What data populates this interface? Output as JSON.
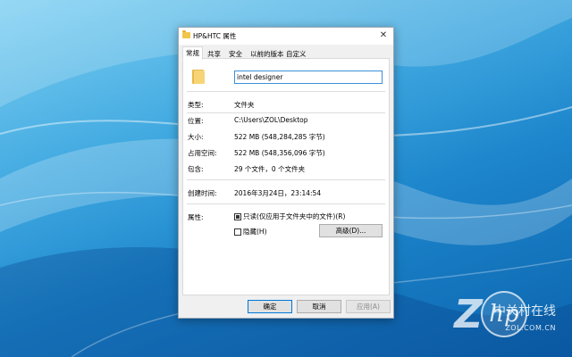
{
  "window": {
    "title": "HP&HTC 属性",
    "close_glyph": "✕"
  },
  "tabs": [
    {
      "label": "常规",
      "active": true
    },
    {
      "label": "共享"
    },
    {
      "label": "安全"
    },
    {
      "label": "以前的版本"
    },
    {
      "label": "自定义"
    }
  ],
  "general": {
    "name_value": "intel designer",
    "type_label": "类型:",
    "type_value": "文件夹",
    "location_label": "位置:",
    "location_value": "C:\\Users\\ZOL\\Desktop",
    "size_label": "大小:",
    "size_value": "522 MB (548,284,285 字节)",
    "size_on_disk_label": "占用空间:",
    "size_on_disk_value": "522 MB (548,356,096 字节)",
    "contains_label": "包含:",
    "contains_value": "29 个文件，0 个文件夹",
    "created_label": "创建时间:",
    "created_value": "2016年3月24日，23:14:54",
    "attributes_label": "属性:",
    "readonly_label": "只读(仅应用于文件夹中的文件)(R)",
    "readonly_state": "indeterminate",
    "hidden_label": "隐藏(H)",
    "hidden_state": "unchecked",
    "advanced_button": "高级(D)..."
  },
  "footer": {
    "ok_label": "确定",
    "cancel_label": "取消",
    "apply_label": "应用(A)"
  },
  "watermark": {
    "logo_letter": "Z",
    "cn_text": "中关村在线",
    "en_text": "ZOL.COM.CN"
  },
  "colors": {
    "accent": "#0078d7",
    "folder": "#f7d576"
  }
}
